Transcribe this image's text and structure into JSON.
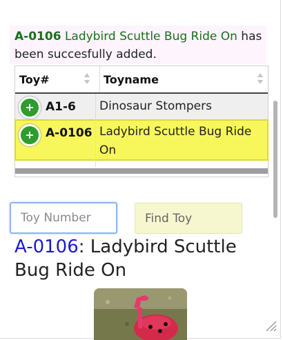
{
  "notice": {
    "toy_id": "A-0106",
    "toy_name": "Ladybird Scuttle Bug Ride On",
    "message_rest": "has been succesfully added."
  },
  "table": {
    "headers": [
      "Toy#",
      "Toyname"
    ],
    "rows": [
      {
        "toy_number": "A1-6",
        "toy_name": "Dinosaur Stompers",
        "highlighted": false
      },
      {
        "toy_number": "A-0106",
        "toy_name": "Ladybird Scuttle Bug Ride On",
        "highlighted": true
      }
    ],
    "add_symbol": "+"
  },
  "search": {
    "placeholder": "Toy Number",
    "value": "",
    "find_label": "Find Toy"
  },
  "result": {
    "toy_id": "A-0106",
    "separator": ":",
    "toy_name": "Ladybird Scuttle Bug Ride On"
  },
  "colors": {
    "notice_background": "#fdf4fd",
    "notice_text": "#1a6e1a",
    "selected_row": "#f7f75c",
    "add_button": "#2e9d2e",
    "find_button": "#f7f7cf",
    "result_link": "#1a1acc"
  },
  "icons": {
    "add": "plus-circle-icon",
    "sort": "sort-arrows-icon",
    "resize": "resize-grip-icon"
  }
}
